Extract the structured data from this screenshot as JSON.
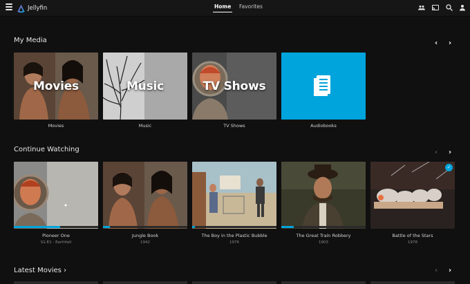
{
  "header": {
    "logo_text": "Jellyfin",
    "tabs": [
      {
        "label": "Home",
        "active": true
      },
      {
        "label": "Favorites",
        "active": false
      }
    ],
    "icons": [
      "users-icon",
      "cast-icon",
      "search-icon",
      "user-icon"
    ]
  },
  "sections": {
    "my_media": {
      "title": "My Media",
      "prev_enabled": true,
      "next_enabled": true,
      "items": [
        {
          "overlay": "Movies",
          "caption": "Movies"
        },
        {
          "overlay": "Music",
          "caption": "Music"
        },
        {
          "overlay": "TV Shows",
          "caption": "TV Shows"
        },
        {
          "overlay": "",
          "caption": "Audiobooks"
        }
      ]
    },
    "continue_watching": {
      "title": "Continue Watching",
      "prev_enabled": false,
      "next_enabled": true,
      "items": [
        {
          "title": "Pioneer One",
          "sub": "S1:E1 - Earthfall",
          "progress": 0.55
        },
        {
          "title": "Jungle Book",
          "sub": "1942",
          "progress": 0.08
        },
        {
          "title": "The Boy in the Plastic Bubble",
          "sub": "1976",
          "progress": 0.03
        },
        {
          "title": "The Great Train Robbery",
          "sub": "1903",
          "progress": 0.15
        },
        {
          "title": "Battle of the Stars",
          "sub": "1978",
          "progress": 0,
          "watched": true
        }
      ]
    },
    "latest_movies": {
      "title": "Latest Movies ›",
      "prev_enabled": false,
      "next_enabled": true
    }
  },
  "colors": {
    "accent": "#00a4dc",
    "background": "#101010",
    "header": "#161616"
  }
}
